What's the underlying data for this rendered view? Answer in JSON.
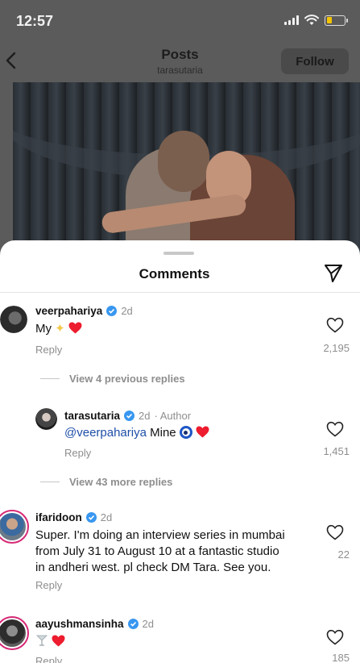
{
  "status_bar": {
    "time": "12:57"
  },
  "header": {
    "title": "Posts",
    "subtitle": "tarasutaria",
    "follow_label": "Follow"
  },
  "comments_sheet": {
    "title": "Comments",
    "reply_label": "Reply",
    "comments": [
      {
        "username": "veerpahariya",
        "verified": true,
        "time": "2d",
        "text": "My",
        "emojis": [
          "sparkle",
          "red-heart"
        ],
        "likes": "2,195"
      },
      {
        "view_replies": "View 4 previous replies"
      },
      {
        "username": "tarasutaria",
        "verified": true,
        "time": "2d",
        "author_tag": "· Author",
        "mention": "@veerpahariya",
        "text": "Mine",
        "emojis": [
          "nazar-amulet",
          "red-heart"
        ],
        "likes": "1,451"
      },
      {
        "view_replies": "View 43 more replies"
      },
      {
        "username": "ifaridoon",
        "verified": true,
        "time": "2d",
        "lines": [
          "Super. I'm doing an interview series in mumbai",
          "from July 31 to August 10 at a fantastic studio",
          "in andheri west. pl check DM Tara. See you."
        ],
        "likes": "22"
      },
      {
        "username": "aayushmansinha",
        "verified": true,
        "time": "2d",
        "emojis": [
          "cocktail-glass",
          "red-heart"
        ],
        "likes": "185"
      }
    ]
  },
  "colors": {
    "verified": "#3897f0",
    "heart": "#ed1c2e",
    "story_ring": "#d62976",
    "mention": "#1f4fa8"
  }
}
